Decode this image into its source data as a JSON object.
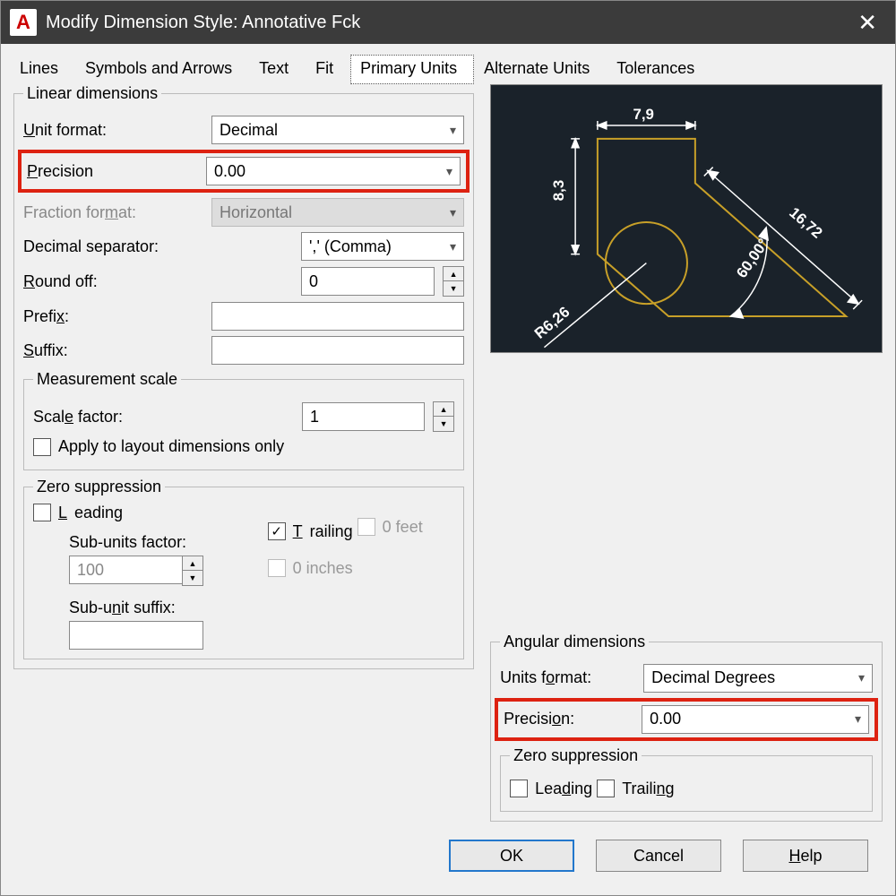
{
  "window": {
    "title": "Modify Dimension Style: Annotative Fck",
    "close": "✕"
  },
  "tabs": [
    "Lines",
    "Symbols and Arrows",
    "Text",
    "Fit",
    "Primary Units",
    "Alternate Units",
    "Tolerances"
  ],
  "active_tab": "Primary Units",
  "linear": {
    "legend": "Linear dimensions",
    "unit_format_label": "Unit format:",
    "unit_format": "Decimal",
    "precision_label": "Precision",
    "precision": "0.00",
    "fraction_format_label": "Fraction format:",
    "fraction_format": "Horizontal",
    "decimal_sep_label": "Decimal separator:",
    "decimal_sep": "',' (Comma)",
    "round_off_label": "Round off:",
    "round_off": "0",
    "prefix_label": "Prefix:",
    "prefix": "",
    "suffix_label": "Suffix:",
    "suffix": ""
  },
  "scale": {
    "legend": "Measurement scale",
    "factor_label": "Scale factor:",
    "factor": "1",
    "apply_layout": "Apply to layout dimensions only"
  },
  "zero_l": {
    "legend": "Zero suppression",
    "leading": "Leading",
    "trailing": "Trailing",
    "subunits_factor_label": "Sub-units factor:",
    "subunits_factor": "100",
    "subunit_suffix_label": "Sub-unit suffix:",
    "subunit_suffix": "",
    "zero_feet": "0 feet",
    "zero_inches": "0 inches"
  },
  "angular": {
    "legend": "Angular dimensions",
    "units_format_label": "Units format:",
    "units_format": "Decimal Degrees",
    "precision_label": "Precision:",
    "precision": "0.00"
  },
  "zero_a": {
    "legend": "Zero suppression",
    "leading": "Leading",
    "trailing": "Trailing"
  },
  "preview": {
    "dim1": "7,9",
    "dim2": "8,3",
    "dim3": "16,72",
    "dim4": "60,00°",
    "dim5": "R6,26"
  },
  "buttons": {
    "ok": "OK",
    "cancel": "Cancel",
    "help": "Help"
  }
}
